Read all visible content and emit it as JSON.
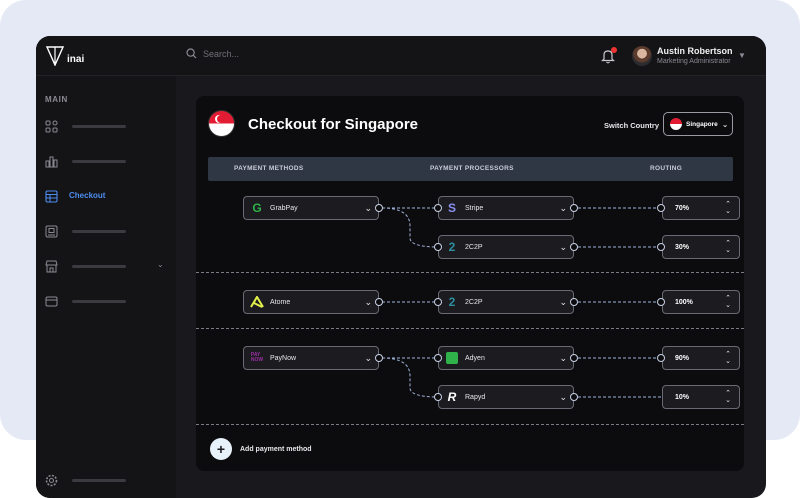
{
  "app": {
    "logo_text": "inai"
  },
  "search": {
    "placeholder": "Search..."
  },
  "user": {
    "name": "Austin Robertson",
    "role": "Marketing Administrator"
  },
  "sidebar": {
    "heading": "MAIN",
    "items": [
      {
        "icon": "grid-icon",
        "label": ""
      },
      {
        "icon": "bar-chart-icon",
        "label": ""
      },
      {
        "icon": "table-icon",
        "label": "Checkout",
        "active": true
      },
      {
        "icon": "document-icon",
        "label": ""
      },
      {
        "icon": "store-icon",
        "label": ""
      },
      {
        "icon": "card-icon",
        "label": ""
      }
    ],
    "settings_icon": "gear-icon"
  },
  "page": {
    "title": "Checkout for Singapore",
    "switch_country_label": "Switch Country",
    "country": "Singapore"
  },
  "columns": {
    "methods": "PAYMENT METHODS",
    "processors": "PAYMENT PROCESSORS",
    "routing": "ROUTING"
  },
  "groups": [
    {
      "method": {
        "name": "GrabPay",
        "icon": "grabpay-logo"
      },
      "routes": [
        {
          "processor": "Stripe",
          "icon": "stripe-logo",
          "routing": "70%"
        },
        {
          "processor": "2C2P",
          "icon": "2c2p-logo",
          "routing": "30%"
        }
      ]
    },
    {
      "method": {
        "name": "Atome",
        "icon": "atome-logo"
      },
      "routes": [
        {
          "processor": "2C2P",
          "icon": "2c2p-logo",
          "routing": "100%"
        }
      ]
    },
    {
      "method": {
        "name": "PayNow",
        "icon": "paynow-logo"
      },
      "routes": [
        {
          "processor": "Adyen",
          "icon": "adyen-logo",
          "routing": "90%"
        },
        {
          "processor": "Rapyd",
          "icon": "rapyd-logo",
          "routing": "10%"
        }
      ]
    }
  ],
  "actions": {
    "add_payment_method": "Add payment method"
  },
  "colors": {
    "accent": "#4d8df0",
    "panel": "#0c0c0e",
    "header": "#2f3745",
    "connector": "#9fb3d9"
  }
}
